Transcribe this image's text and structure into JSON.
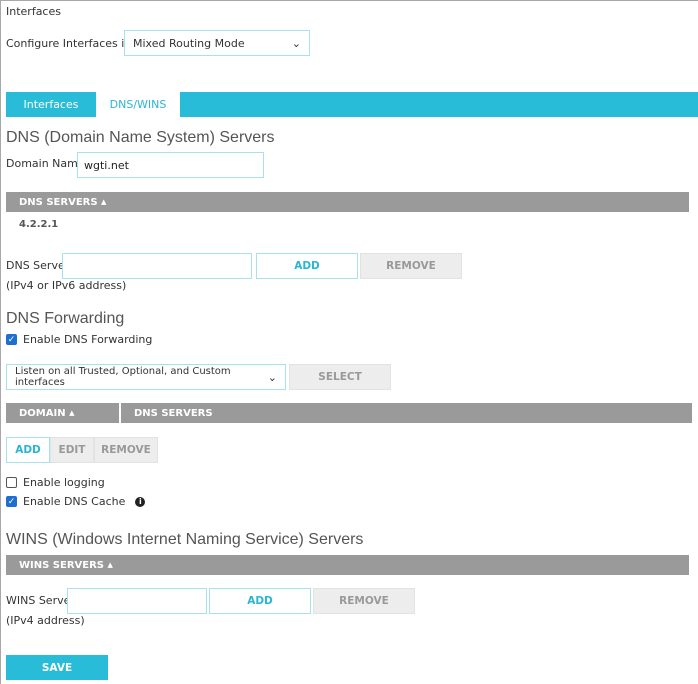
{
  "page": {
    "title": "Interfaces",
    "configure_label": "Configure Interfaces in",
    "mode_value": "Mixed Routing Mode"
  },
  "tabs": [
    {
      "label": "Interfaces",
      "active": false
    },
    {
      "label": "DNS/WINS",
      "active": true
    }
  ],
  "dns": {
    "heading": "DNS (Domain Name System) Servers",
    "domain_label": "Domain Name",
    "domain_value": "wgti.net",
    "table_header": "DNS SERVERS",
    "servers": [
      "4.2.2.1"
    ],
    "server_label": "DNS Server",
    "server_value": "",
    "hint": "(IPv4 or IPv6 address)",
    "add": "ADD",
    "remove": "REMOVE"
  },
  "forwarding": {
    "heading": "DNS Forwarding",
    "enable_label": "Enable DNS Forwarding",
    "enabled": true,
    "listen_value": "Listen on all Trusted, Optional, and Custom interfaces",
    "select": "SELECT",
    "col_domain": "DOMAIN",
    "col_servers": "DNS SERVERS",
    "add": "ADD",
    "edit": "EDIT",
    "remove": "REMOVE",
    "logging_label": "Enable logging",
    "logging": false,
    "cache_label": "Enable DNS Cache",
    "cache": true
  },
  "wins": {
    "heading": "WINS (Windows Internet Naming Service) Servers",
    "table_header": "WINS SERVERS",
    "server_label": "WINS Server",
    "server_value": "",
    "hint": "(IPv4 address)",
    "add": "ADD",
    "remove": "REMOVE"
  },
  "save": "SAVE",
  "colors": {
    "accent": "#29bcd8",
    "header_gray": "#9a9a9a"
  }
}
